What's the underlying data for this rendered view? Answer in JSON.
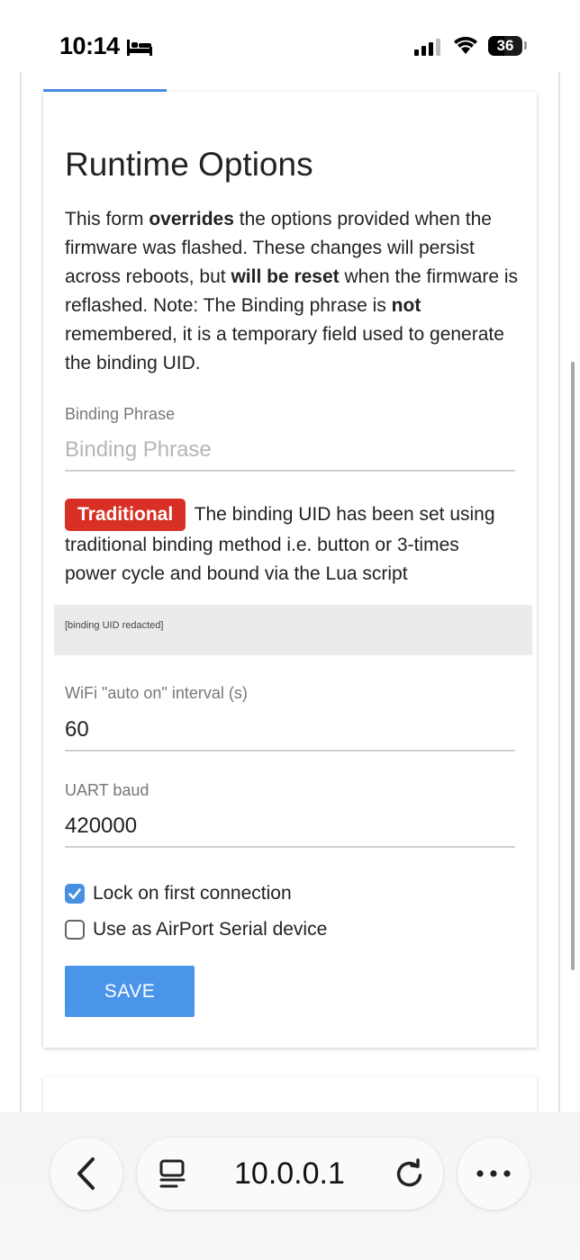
{
  "status_bar": {
    "time": "10:14",
    "battery": "36"
  },
  "card": {
    "title": "Runtime Options",
    "intro": {
      "p1": "This form ",
      "b1": "overrides",
      "p2": " the options provided when the firmware was flashed. These changes will persist across reboots, but ",
      "b2": "will be reset",
      "p3": " when the firmware is reflashed. Note: The Binding phrase is ",
      "b3": "not",
      "p4": " remembered, it is a temporary field used to generate the binding UID."
    },
    "binding_phrase": {
      "label": "Binding Phrase",
      "placeholder": "Binding Phrase",
      "value": ""
    },
    "binding_notice": {
      "badge": "Traditional",
      "text": "The binding UID has been set using traditional binding method i.e. button or 3-times power cycle and bound via the Lua script"
    },
    "binding_uid": "[binding UID redacted]",
    "wifi_interval": {
      "label": "WiFi \"auto on\" interval (s)",
      "value": "60"
    },
    "uart_baud": {
      "label": "UART baud",
      "value": "420000"
    },
    "lock_first_connection": {
      "label": "Lock on first connection",
      "checked": true
    },
    "airport_serial": {
      "label": "Use as AirPort Serial device",
      "checked": false
    },
    "save_label": "SAVE"
  },
  "browser": {
    "url": "10.0.0.1",
    "icons": {
      "back": "chevron-left-icon",
      "reader": "reader-mode-icon",
      "reload": "reload-icon",
      "more": "more-icon"
    }
  },
  "colors": {
    "accent": "#4a90e2",
    "badge": "#d93025"
  }
}
